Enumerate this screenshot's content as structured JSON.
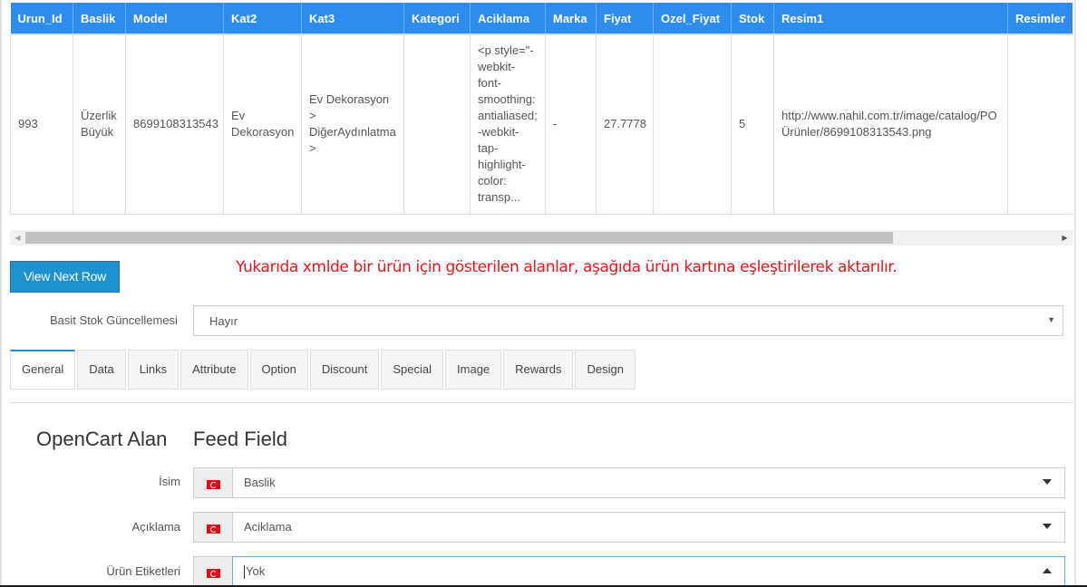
{
  "table": {
    "columns": [
      "Urun_Id",
      "Baslik",
      "Model",
      "Kat2",
      "Kat3",
      "Kategori",
      "Aciklama",
      "Marka",
      "Fiyat",
      "Ozel_Fiyat",
      "Stok",
      "Resim1",
      "Resimler"
    ],
    "row": {
      "urun_id": "993",
      "baslik": "Üzerlik Büyük",
      "model": "8699108313543",
      "kat2": "Ev Dekorasyon",
      "kat3": "Ev Dekorasyon > DiğerAydınlatma >",
      "kategori": "",
      "aciklama": "<p style=\"-webkit-font-smoothing: antialiased; -webkit-tap-highlight-color: transp...",
      "marka": "-",
      "fiyat": "27.7778",
      "ozel_fiyat": "",
      "stok": "5",
      "resim1": "http://www.nahil.com.tr/image/catalog/PO Ürünler/8699108313543.png",
      "resimler": ""
    }
  },
  "buttons": {
    "view_next_row": "View Next Row"
  },
  "notice": "Yukarıda xmlde bir ürün için gösterilen alanlar, aşağıda ürün kartına eşleştirilerek aktarılır.",
  "stock_update": {
    "label": "Basit Stok Güncellemesi",
    "value": "Hayır"
  },
  "tabs": [
    {
      "label": "General",
      "active": true
    },
    {
      "label": "Data"
    },
    {
      "label": "Links"
    },
    {
      "label": "Attribute"
    },
    {
      "label": "Option"
    },
    {
      "label": "Discount"
    },
    {
      "label": "Special"
    },
    {
      "label": "Image"
    },
    {
      "label": "Rewards"
    },
    {
      "label": "Design"
    }
  ],
  "mapping": {
    "col1_heading": "OpenCart Alan",
    "col2_heading": "Feed Field",
    "fields": [
      {
        "label": "İsim",
        "value": "Baslik",
        "flag": "turkey-flag-icon"
      },
      {
        "label": "Açıklama",
        "value": "Aciklama",
        "flag": "turkey-flag-icon"
      },
      {
        "label": "Ürün Etiketleri",
        "value": "Yok",
        "flag": "turkey-flag-icon",
        "open": true
      }
    ]
  },
  "colors": {
    "header_blue": "#2e8cef",
    "button_blue": "#1e91cf",
    "notice_red": "#e8141a"
  }
}
